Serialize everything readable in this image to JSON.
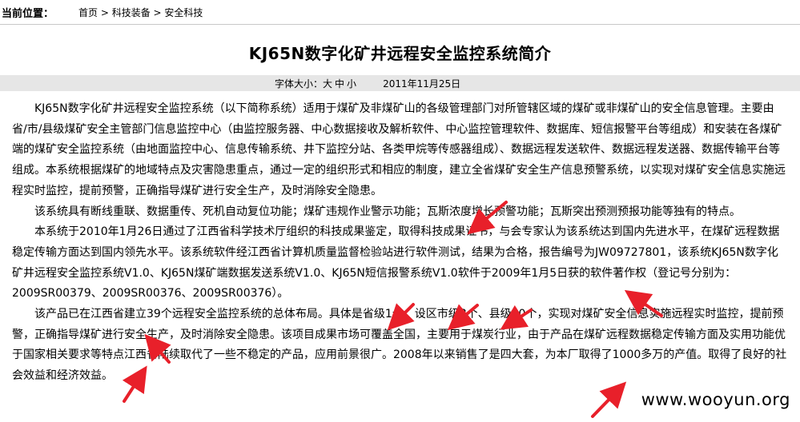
{
  "breadcrumb": {
    "label": "当前位置：",
    "items": [
      "首页",
      "科技装备",
      "安全科技"
    ],
    "separator": " > "
  },
  "article": {
    "title": "KJ65N数字化矿井远程安全监控系统简介",
    "meta": {
      "font_size_label": "字体大小：",
      "font_sizes": [
        "大",
        "中",
        "小"
      ],
      "date": "2011年11月25日"
    },
    "paragraphs": [
      "KJ65N数字化矿井远程安全监控系统（以下简称系统）适用于煤矿及非煤矿山的各级管理部门对所管辖区域的煤矿或非煤矿山的安全信息管理。主要由省/市/县级煤矿安全主管部门信息监控中心（由监控服务器、中心数据接收及解析软件、中心监控管理软件、数据库、短信报警平台等组成）和安装在各煤矿端的煤矿安全监控系统（由地面监控中心、信息传输系统、井下监控分站、各类甲烷等传感器组成）、数据远程发送软件、数据远程发送器、数据传输平台等组成。本系统根据煤矿的地域特点及灾害隐患重点，通过一定的组织形式和相应的制度，建立全省煤矿安全生产信息预警系统，以实现对煤矿安全信息实施远程实时监控，提前预警，正确指导煤矿进行安全生产，及时消除安全隐患。",
      "该系统具有断线重联、数据重传、死机自动复位功能；煤矿违规作业警示功能；瓦斯浓度增长预警功能；瓦斯突出预测预报功能等独有的特点。",
      "本系统于2010年1月26日通过了江西省科学技术厅组织的科技成果鉴定，取得科技成果证书，与会专家认为该系统达到国内先进水平，在煤矿远程数据稳定传输方面达到国内领先水平。该系统软件经江西省计算机质量监督检验站进行软件测试，结果为合格，报告编号为JW09727801，该系统KJ65N数字化矿井远程安全监控系统V1.0、KJ65N煤矿端数据发送系统V1.0、KJ65N短信报警系统V1.0软件于2009年1月5日获的软件著作权（登记号分别为：2009SR00379、2009SR00376、2009SR00376）。",
      "该产品已在江西省建立39个远程安全监控系统的总体布局。具体是省级1个、设区市级8个、县级30个，实现对煤矿安全信息实施远程实时监控，提前预警，正确指导煤矿进行安全生产，及时消除安全隐患。该项目成果市场可覆盖全国，主要用于煤炭行业，由于产品在煤矿远程数据稳定传输方面及实用功能优于国家相关要求等特点江西省陆续取代了一些不稳定的产品，应用前景很广。2008年以来销售了是四大套，为本厂取得了1000多万的产值。取得了良好的社会效益和经济效益。"
    ]
  },
  "watermark": "www.wooyun.org",
  "colors": {
    "annotation_arrow": "#e8202a",
    "meta_bar_bg": "#e6e6e6"
  }
}
